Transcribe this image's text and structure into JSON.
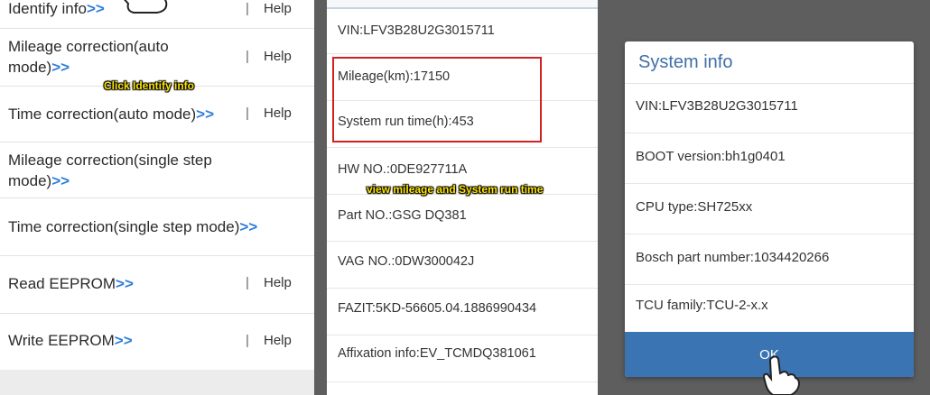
{
  "left_menu": {
    "items": [
      {
        "label": "Identify info",
        "arrows": ">>",
        "help": "Help"
      },
      {
        "label_line1": "Mileage correction(auto",
        "label_line2": "mode)",
        "arrows": ">>",
        "help": "Help"
      },
      {
        "label": "Time correction(auto mode)",
        "arrows": ">>",
        "help": "Help"
      },
      {
        "label_line1": "Mileage correction(single step",
        "label_line2": "mode)",
        "arrows": ">>"
      },
      {
        "label": "Time correction(single step mode)",
        "arrows": ">>"
      },
      {
        "label": "Read EEPROM",
        "arrows": ">>",
        "help": "Help"
      },
      {
        "label": "Write EEPROM",
        "arrows": ">>",
        "help": "Help"
      }
    ],
    "separator": "|"
  },
  "captions": {
    "click_identify": "Click Identify info",
    "view_mileage": "view mileage and System run time"
  },
  "device_info": {
    "rows": [
      "VIN:LFV3B28U2G3015711",
      "Mileage(km):17150",
      "System run time(h):453",
      "HW NO.:0DE927711A",
      "Part NO.:GSG DQ381",
      "VAG NO.:0DW300042J",
      "FAZIT:5KD-56605.04.1886990434",
      "Affixation info:EV_TCMDQ381061"
    ]
  },
  "dialog": {
    "title": "System info",
    "rows": [
      "VIN:LFV3B28U2G3015711",
      "BOOT version:bh1g0401",
      "CPU type:SH725xx",
      "Bosch part number:1034420266",
      "TCU family:TCU-2-x.x"
    ],
    "ok_label": "OK"
  },
  "colors": {
    "accent_blue": "#2f7ed8",
    "dialog_title": "#3f6fa8",
    "ok_button": "#3a74b3",
    "highlight_red": "#d32020",
    "caption_yellow": "#ffe600"
  },
  "icons": [
    "hand-pointer-icon"
  ]
}
